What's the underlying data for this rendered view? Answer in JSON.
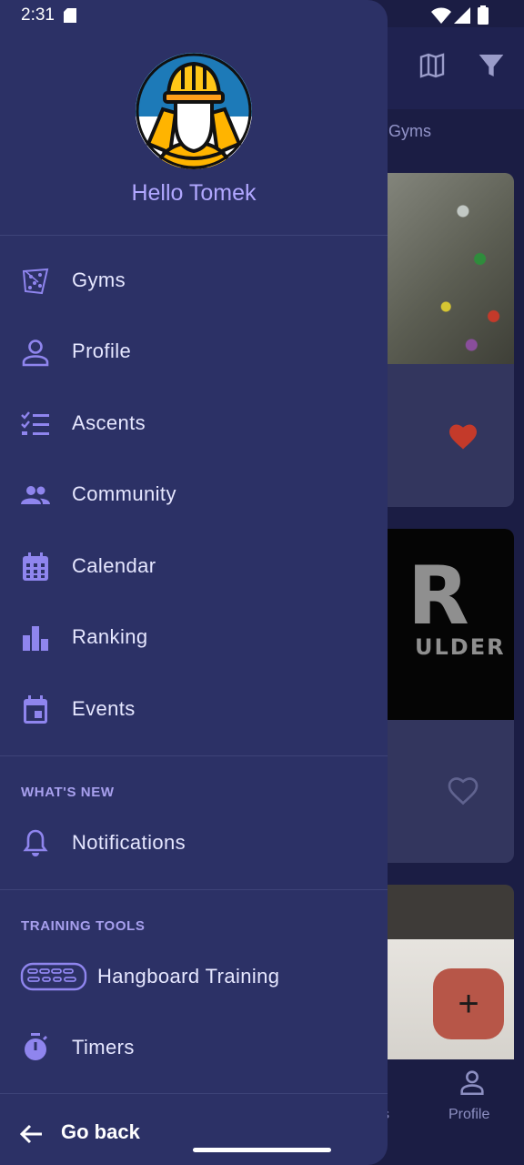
{
  "status_bar": {
    "time": "2:31"
  },
  "drawer": {
    "greeting": "Hello Tomek",
    "main_items": [
      {
        "label": "Gyms",
        "icon": "climbing-wall-icon"
      },
      {
        "label": "Profile",
        "icon": "person-icon"
      },
      {
        "label": "Ascents",
        "icon": "checklist-icon"
      },
      {
        "label": "Community",
        "icon": "group-icon"
      },
      {
        "label": "Calendar",
        "icon": "calendar-icon"
      },
      {
        "label": "Ranking",
        "icon": "bar-chart-icon"
      },
      {
        "label": "Events",
        "icon": "event-icon"
      }
    ],
    "whats_new": {
      "title": "WHAT'S NEW",
      "items": [
        {
          "label": "Notifications",
          "icon": "bell-icon"
        }
      ]
    },
    "training_tools": {
      "title": "TRAINING TOOLS",
      "items": [
        {
          "label": "Hangboard Training",
          "icon": "hangboard-icon"
        },
        {
          "label": "Timers",
          "icon": "stopwatch-icon"
        }
      ]
    },
    "go_back": "Go back"
  },
  "background": {
    "tab_fragment": "e Gyms",
    "card_logo_big": "R",
    "card_logo_small": "ULDER",
    "bottom_nav_profile": "Profile",
    "bottom_nav_fragment": "s",
    "fab": "+"
  },
  "colors": {
    "drawer": "#2c3166",
    "accent": "#b1a7ff",
    "heart": "#c43a2a",
    "fab": "#b75648"
  }
}
